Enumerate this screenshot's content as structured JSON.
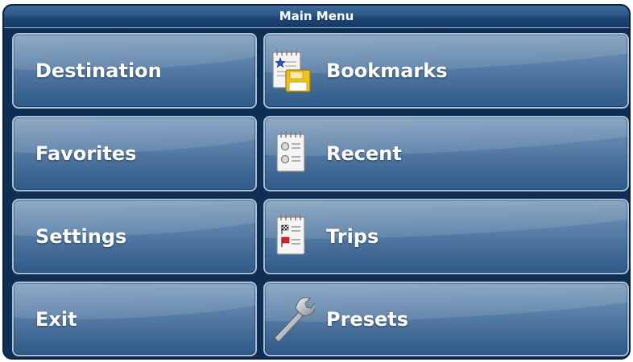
{
  "title": "Main Menu",
  "left_buttons": [
    {
      "label": "Destination"
    },
    {
      "label": "Favorites"
    },
    {
      "label": "Settings"
    },
    {
      "label": "Exit"
    }
  ],
  "right_buttons": [
    {
      "label": "Bookmarks",
      "icon": "bookmarks-notepad-floppy-icon"
    },
    {
      "label": "Recent",
      "icon": "recent-notepad-icon"
    },
    {
      "label": "Trips",
      "icon": "trips-notepad-flags-icon"
    },
    {
      "label": "Presets",
      "icon": "wrench-icon"
    }
  ],
  "colors": {
    "frame": "#0f2e53",
    "button": "#5a80a8",
    "button_border": "#a9bfd3",
    "text": "#ffffff",
    "floppy": "#f0c020"
  }
}
